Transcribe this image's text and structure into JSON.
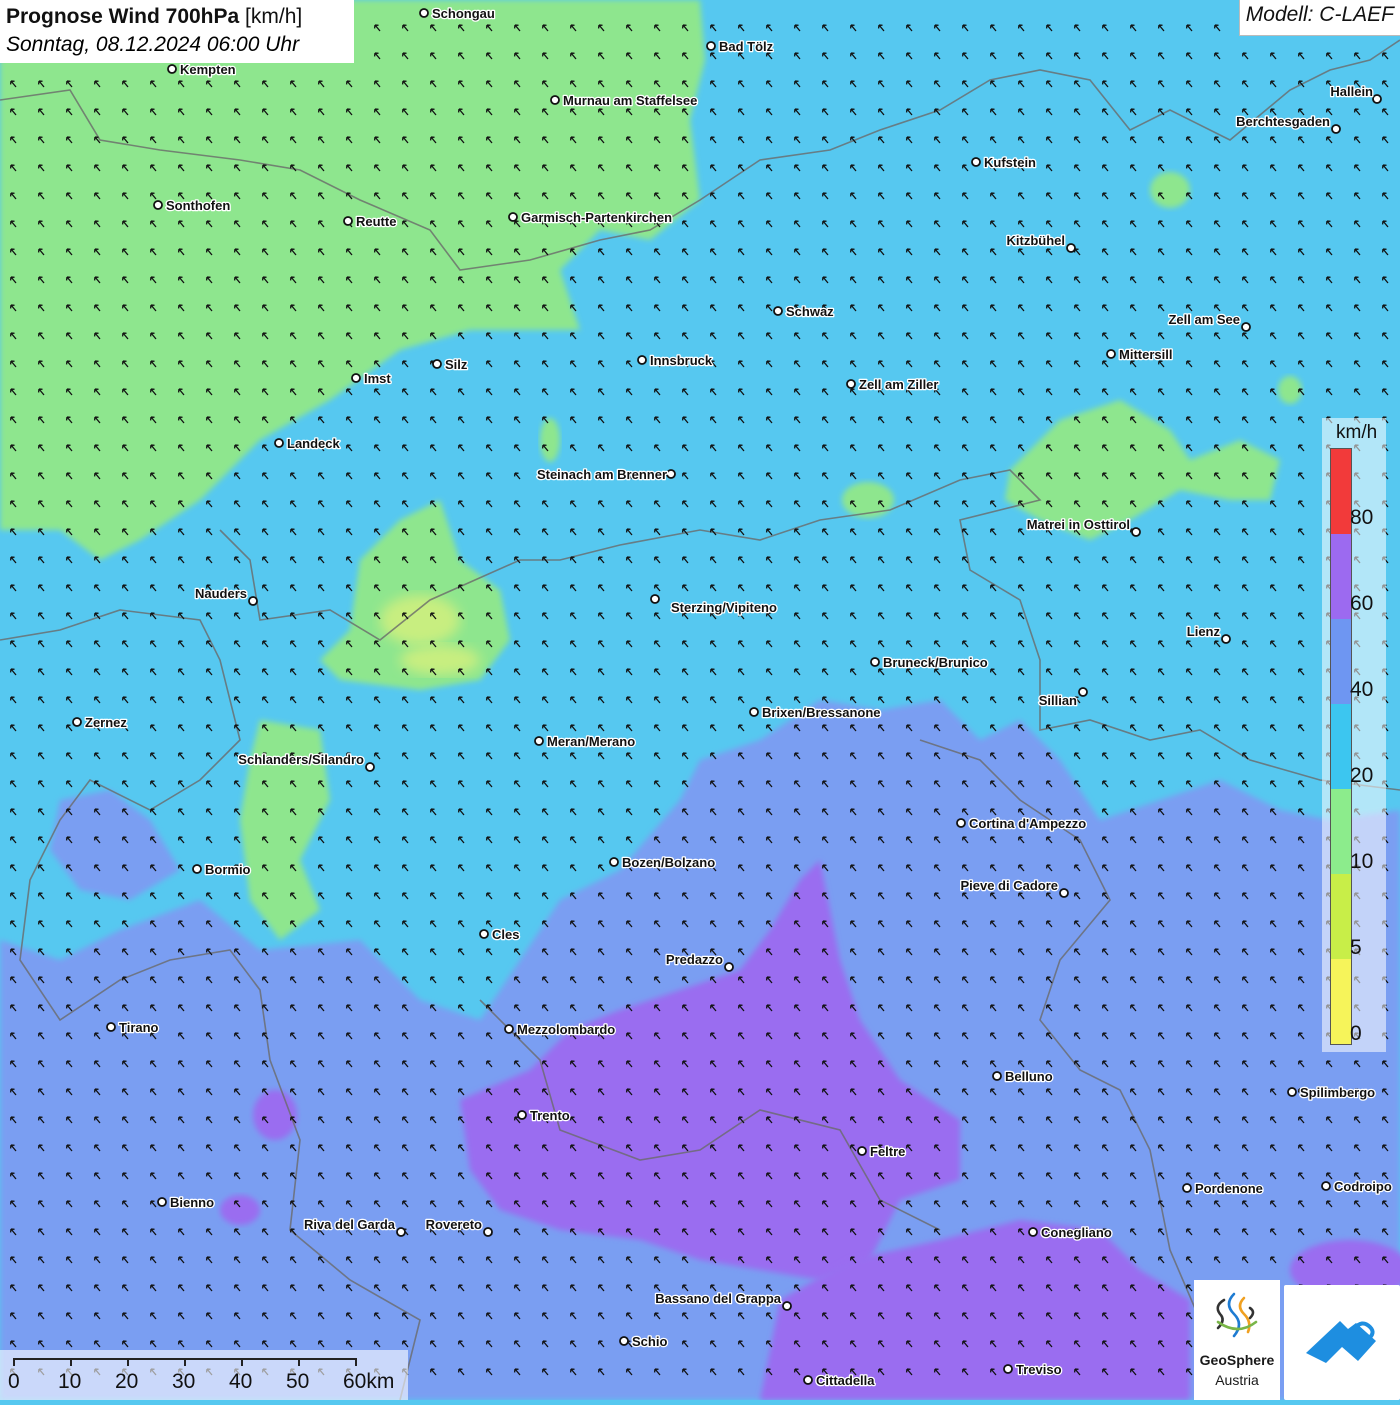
{
  "title": {
    "main": "Prognose Wind 700hPa",
    "unit": "[km/h]",
    "subtitle": "Sonntag, 08.12.2024 06:00 Uhr"
  },
  "model": "Modell: C-LAEF",
  "legend": {
    "unit": "km/h",
    "ticks": [
      "80",
      "60",
      "40",
      "20",
      "10",
      "5",
      "0"
    ],
    "colors": [
      "#f23a3a",
      "#9c6af0",
      "#6e96f2",
      "#3cc6f0",
      "#8cec8c",
      "#c8ee48",
      "#f6f45a"
    ]
  },
  "scale_bar": {
    "labels": [
      "0",
      "10",
      "20",
      "30",
      "40",
      "50",
      "60km"
    ]
  },
  "logos": {
    "geosphere_name": "GeoSphere",
    "geosphere_sub": "Austria"
  },
  "wind": {
    "north_speed_band": "10-20",
    "north_color": "#8ee68e",
    "central_speed_band": "20-40",
    "central_color": "#56c8f0",
    "south_speed_band": "40-60",
    "south_color": "#7a9ef2",
    "max_speed_band": "60-80",
    "max_color": "#9a6df0",
    "arrow_direction": "toward north-west"
  },
  "cities": [
    {
      "name": "Schongau"
    },
    {
      "name": "Bad Tölz"
    },
    {
      "name": "Kempten"
    },
    {
      "name": "Murnau am Staffelsee"
    },
    {
      "name": "Hallein"
    },
    {
      "name": "Berchtesgaden"
    },
    {
      "name": "Kufstein"
    },
    {
      "name": "Sonthofen"
    },
    {
      "name": "Reutte"
    },
    {
      "name": "Garmisch-Partenkirchen"
    },
    {
      "name": "Kitzbühel"
    },
    {
      "name": "Schwaz"
    },
    {
      "name": "Zell am See"
    },
    {
      "name": "Mittersill"
    },
    {
      "name": "Silz"
    },
    {
      "name": "Innsbruck"
    },
    {
      "name": "Imst"
    },
    {
      "name": "Zell am Ziller"
    },
    {
      "name": "Landeck"
    },
    {
      "name": "Steinach am Brenner"
    },
    {
      "name": "Matrei in Osttirol"
    },
    {
      "name": "Nauders"
    },
    {
      "name": "Sterzing/Vipiteno"
    },
    {
      "name": "Lienz"
    },
    {
      "name": "Bruneck/Brunico"
    },
    {
      "name": "Sillian"
    },
    {
      "name": "Brixen/Bressanone"
    },
    {
      "name": "Zernez"
    },
    {
      "name": "Meran/Merano"
    },
    {
      "name": "Schlanders/Silandro"
    },
    {
      "name": "Cortina d'Ampezzo"
    },
    {
      "name": "Bozen/Bolzano"
    },
    {
      "name": "Bormio"
    },
    {
      "name": "Pieve di Cadore"
    },
    {
      "name": "Cles"
    },
    {
      "name": "Predazzo"
    },
    {
      "name": "Tirano"
    },
    {
      "name": "Mezzolombardo"
    },
    {
      "name": "Belluno"
    },
    {
      "name": "Spilimbergo"
    },
    {
      "name": "Trento"
    },
    {
      "name": "Feltre"
    },
    {
      "name": "Pordenone"
    },
    {
      "name": "Codroipo"
    },
    {
      "name": "Bienno"
    },
    {
      "name": "Riva del Garda"
    },
    {
      "name": "Rovereto"
    },
    {
      "name": "Conegliano"
    },
    {
      "name": "Bassano del Grappa"
    },
    {
      "name": "Schio"
    },
    {
      "name": "Treviso"
    },
    {
      "name": "Cittadella"
    }
  ]
}
